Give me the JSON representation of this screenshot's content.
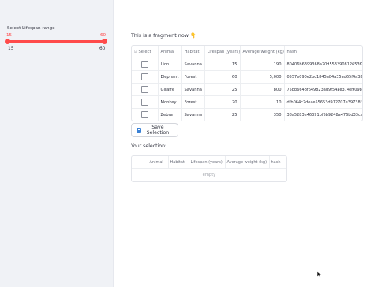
{
  "sidebar": {
    "slider_label": "Select Lifespan range",
    "selected_low": "15",
    "selected_high": "60",
    "min_label": "15",
    "max_label": "60",
    "accent_color": "#ff4b4b"
  },
  "main": {
    "fragment_text": "This is a fragment now",
    "fragment_emoji": "👇",
    "table": {
      "columns": [
        "Select",
        "Animal",
        "Habitat",
        "Lifespan (years)",
        "Average weight (kg)",
        "hash"
      ],
      "rows": [
        {
          "animal": "Lion",
          "habitat": "Savanna",
          "lifespan": "15",
          "weight": "190",
          "hash": "80406b6399368a20d553290812653f7a"
        },
        {
          "animal": "Elephant",
          "habitat": "Forest",
          "lifespan": "60",
          "weight": "5,000",
          "hash": "0557e090e2bc1845a84a35ad65f4a38"
        },
        {
          "animal": "Giraffe",
          "habitat": "Savanna",
          "lifespan": "25",
          "weight": "800",
          "hash": "75bb6648f649823ad9f54ae374e9098af"
        },
        {
          "animal": "Monkey",
          "habitat": "Forest",
          "lifespan": "20",
          "weight": "10",
          "hash": "dfb064c2deae55653d912707e39738f"
        },
        {
          "animal": "Zebra",
          "habitat": "Savanna",
          "lifespan": "25",
          "weight": "350",
          "hash": "38a5283e46391bf5b9248a476bd33ce"
        }
      ]
    },
    "save_button_label": "Save Selection",
    "save_button_icon": "floppy-disk-icon",
    "your_selection_label": "Your selection:",
    "selection_table": {
      "columns": [
        "",
        "Animal",
        "Habitat",
        "Lifespan (years)",
        "Average weight (kg)",
        "hash"
      ],
      "empty_text": "empty"
    }
  }
}
